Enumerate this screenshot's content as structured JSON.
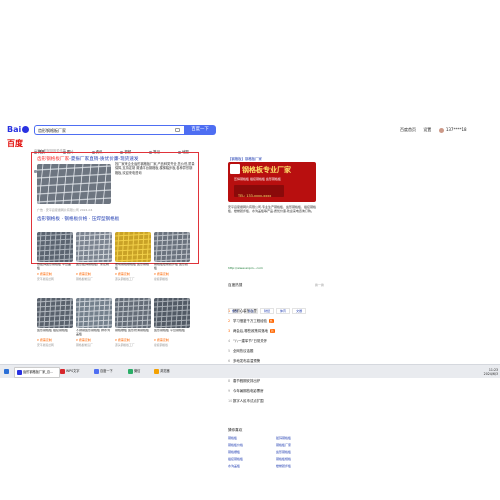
{
  "header": {
    "logo_part1": "Bai",
    "logo_part2": "百度",
    "search_value": "齿形钢格板厂家",
    "search_button": "百度一下",
    "top_right": [
      "百度首页",
      "设置",
      "137****18"
    ]
  },
  "tabs": [
    "网页",
    "图片",
    "资讯",
    "视频",
    "笔记",
    "地图",
    "更多"
  ],
  "result_info": "百度为您找到相关结果",
  "ad": {
    "title_before": "齿形钢格板厂家",
    "title_after": "-夏振厂家直销-质优价廉-现货速发",
    "description": "找厂家来企业齿形钢格板厂家,产品种类齐全,售价低,质量保障,支持定制 普通平台钢格板,楼梯踏步板,各种异形钢格板,欢迎来电咨询",
    "source": "广告 · 安平县夏振网片有限公司 2024-04",
    "links": [
      "齿形钢格板",
      "钢格板价格",
      "压焊型钢格板"
    ]
  },
  "products": [
    {
      "title": "热镀锌齿形钢格板 平台盖板",
      "price": "¥  按需定制",
      "shop": "安平夏振丝网"
    },
    {
      "title": "齿形镀锌钢格板厂家定制",
      "price": "¥  按需定制",
      "shop": "钢格板制造厂"
    },
    {
      "title": "玻璃钢格栅格板 齿形钢格板",
      "price": "¥  按需定制",
      "shop": "源头钢格板工厂"
    },
    {
      "title": "钢格板楼梯踏步板 齿形踏板",
      "price": "¥  按需定制",
      "shop": "夏振钢格板"
    },
    {
      "title": "齿形钢格板 插接钢格板",
      "price": "¥  按需定制",
      "shop": "安平夏振丝网"
    },
    {
      "title": "不锈钢齿形钢格板 排水沟盖板",
      "price": "¥  按需定制",
      "shop": "钢格板制造厂"
    },
    {
      "title": "钢格栅板 齿形防滑钢格板",
      "price": "¥  按需定制",
      "shop": "源头钢格板工厂"
    },
    {
      "title": "齿形钢格板 平台钢格板",
      "price": "¥  按需定制",
      "shop": "夏振钢格板"
    }
  ],
  "right_card": {
    "head": "【钢格板】钢格板厂家",
    "banner_title": "钢格板专业厂家",
    "banner_sub": "压焊钢格板 插接钢格板 齿形钢格板",
    "banner_phone": "TEL: 133-xxxx-xxxx",
    "description": "安平县夏振网片有限公司,专业生产钢格板、齿形钢格板、插接钢格板、楼梯踏步板、水沟盖板等产品,质优价廉,欢迎来电咨询订购。",
    "url": "http://www.anpin...com"
  },
  "hot": {
    "head": "百度热搜",
    "refresh": "换一换",
    "tabs": [
      "热搜",
      "民生",
      "财经",
      "体育",
      "文娱"
    ],
    "items": [
      {
        "label": "把初心装在心里",
        "tag": ""
      },
      {
        "label": "学习借鉴千万工程经验",
        "tag": "热"
      },
      {
        "label": "两会后,哪些政策将落地",
        "tag": "新"
      },
      {
        "label": "“八一建军节”日常关怀",
        "tag": ""
      },
      {
        "label": "全网热议话题",
        "tag": ""
      },
      {
        "label": "多地发布高温预警",
        "tag": ""
      },
      {
        "label": "汉帐：这些新规下月施行",
        "tag": "热"
      },
      {
        "label": "春节假期安排出炉",
        "tag": ""
      },
      {
        "label": "今年暑期档电影票房",
        "tag": ""
      },
      {
        "label": "数字人民币试点扩围",
        "tag": ""
      }
    ]
  },
  "bottom": {
    "head": "猜你喜欢",
    "items": [
      "钢格板",
      "镀锌钢格板",
      "钢格板价格",
      "钢格板厂家",
      "钢格栅板",
      "齿形钢格板",
      "插接钢格板",
      "钢格板规格",
      "水沟盖板",
      "楼梯踏步板"
    ]
  },
  "taskbar": {
    "items": [
      "齿形钢格板厂家_百...",
      "WPS文字",
      "百度一下",
      "微信",
      "浏览器"
    ],
    "clock_time": "11:23",
    "clock_date": "2024/6/3"
  }
}
